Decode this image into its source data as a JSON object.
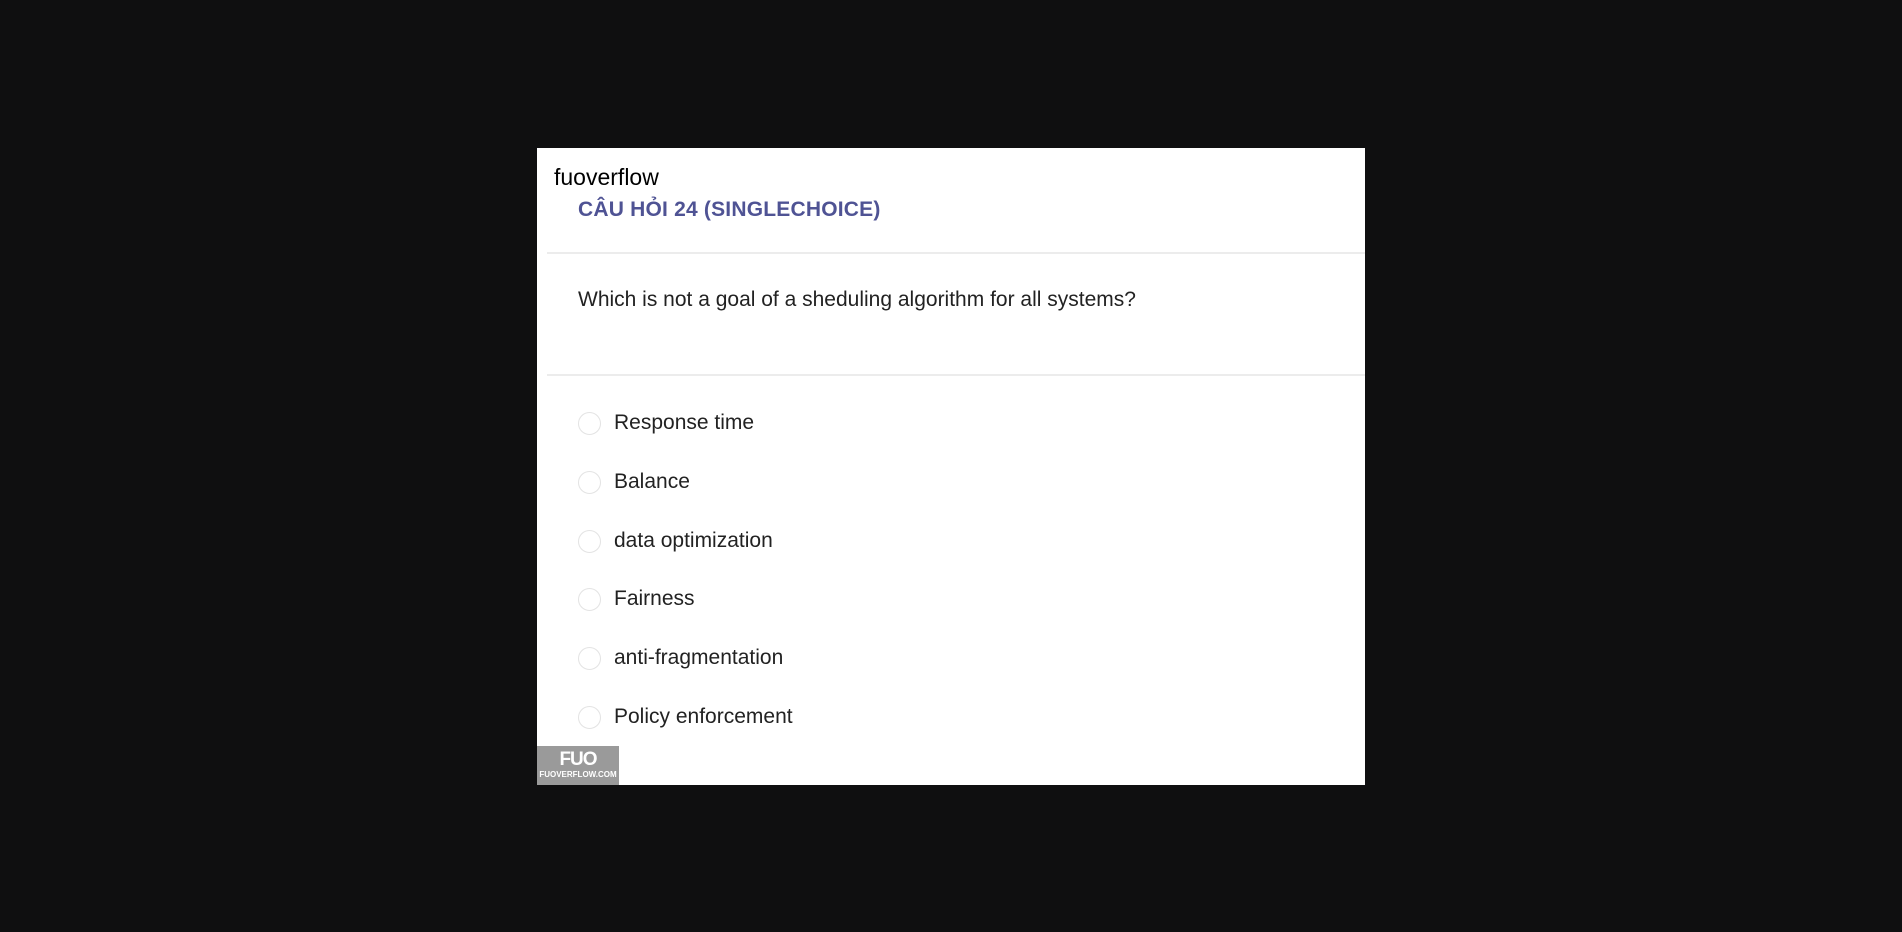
{
  "brand": "fuoverflow",
  "question_header": "CÂU HỎI 24 (SINGLECHOICE)",
  "question_text": "Which is not a goal of a sheduling algorithm for all systems?",
  "options": [
    {
      "label": "Response time"
    },
    {
      "label": "Balance"
    },
    {
      "label": "data optimization"
    },
    {
      "label": "Fairness"
    },
    {
      "label": "anti-fragmentation"
    },
    {
      "label": "Policy enforcement"
    }
  ],
  "logo": {
    "mark": "FUO",
    "site": "FUOVERFLOW.COM"
  },
  "colors": {
    "background": "#0f0f10",
    "title": "#4f5394"
  }
}
